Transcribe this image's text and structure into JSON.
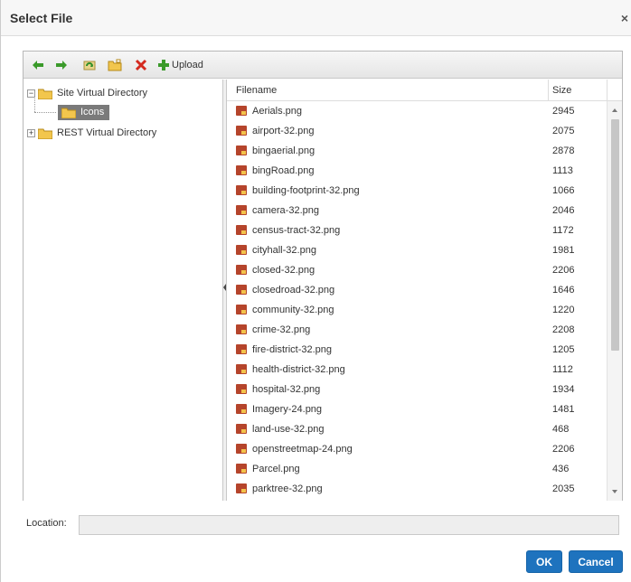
{
  "dialog": {
    "title": "Select File",
    "close_glyph": "×"
  },
  "toolbar": {
    "buttons": [
      {
        "name": "back",
        "icon": "arrow-left-icon"
      },
      {
        "name": "forward",
        "icon": "arrow-right-icon"
      },
      {
        "name": "refresh",
        "icon": "refresh-icon"
      },
      {
        "name": "new-folder",
        "icon": "new-folder-icon"
      },
      {
        "name": "delete",
        "icon": "delete-x-icon"
      },
      {
        "name": "upload",
        "icon": "plus-icon"
      }
    ],
    "upload_label": "Upload"
  },
  "tree": {
    "nodes": [
      {
        "label": "Site Virtual Directory",
        "expanded": true,
        "expander": "−"
      },
      {
        "label": "Icons",
        "selected": true
      },
      {
        "label": "REST Virtual Directory",
        "expanded": false,
        "expander": "+"
      }
    ]
  },
  "grid": {
    "columns": [
      "Filename",
      "Size"
    ],
    "rows": [
      {
        "name": "Aerials.png",
        "size": "2945"
      },
      {
        "name": "airport-32.png",
        "size": "2075"
      },
      {
        "name": "bingaerial.png",
        "size": "2878"
      },
      {
        "name": "bingRoad.png",
        "size": "1113"
      },
      {
        "name": "building-footprint-32.png",
        "size": "1066"
      },
      {
        "name": "camera-32.png",
        "size": "2046"
      },
      {
        "name": "census-tract-32.png",
        "size": "1172"
      },
      {
        "name": "cityhall-32.png",
        "size": "1981"
      },
      {
        "name": "closed-32.png",
        "size": "2206"
      },
      {
        "name": "closedroad-32.png",
        "size": "1646"
      },
      {
        "name": "community-32.png",
        "size": "1220"
      },
      {
        "name": "crime-32.png",
        "size": "2208"
      },
      {
        "name": "fire-district-32.png",
        "size": "1205"
      },
      {
        "name": "health-district-32.png",
        "size": "1112"
      },
      {
        "name": "hospital-32.png",
        "size": "1934"
      },
      {
        "name": "Imagery-24.png",
        "size": "1481"
      },
      {
        "name": "land-use-32.png",
        "size": "468"
      },
      {
        "name": "openstreetmap-24.png",
        "size": "2206"
      },
      {
        "name": "Parcel.png",
        "size": "436"
      },
      {
        "name": "parktree-32.png",
        "size": "2035"
      }
    ]
  },
  "location": {
    "label": "Location:",
    "value": ""
  },
  "buttons": {
    "ok": "OK",
    "cancel": "Cancel"
  },
  "colors": {
    "primary_button": "#1e73be",
    "file_icon": "#b5442b",
    "selected_node": "#7a7a7a"
  }
}
